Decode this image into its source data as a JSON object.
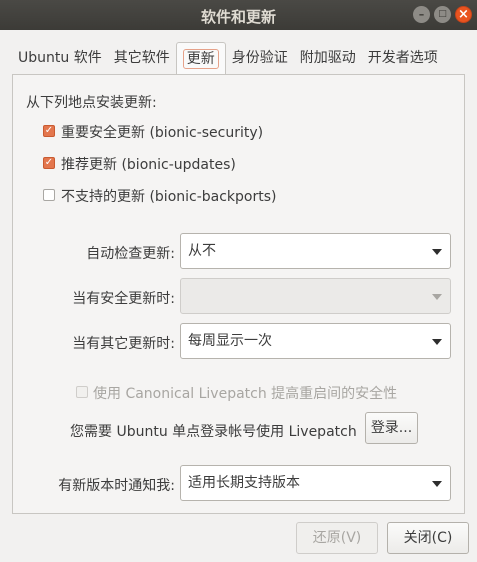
{
  "window": {
    "title": "软件和更新",
    "controls": {
      "minimize_glyph": "–",
      "maximize_glyph": "□",
      "close_glyph": "×"
    }
  },
  "tabs": [
    {
      "label": "Ubuntu 软件"
    },
    {
      "label": "其它软件"
    },
    {
      "label": "更新",
      "active": true
    },
    {
      "label": "身份验证"
    },
    {
      "label": "附加驱动"
    },
    {
      "label": "开发者选项"
    }
  ],
  "updates": {
    "install_from_label": "从下列地点安装更新:",
    "sources": [
      {
        "label": "重要安全更新 (bionic-security)",
        "checked": true
      },
      {
        "label": "推荐更新 (bionic-updates)",
        "checked": true
      },
      {
        "label": "不支持的更新 (bionic-backports)",
        "checked": false
      }
    ],
    "auto_check": {
      "label": "自动检查更新:",
      "value": "从不"
    },
    "security_updates": {
      "label": "当有安全更新时:",
      "value": ""
    },
    "other_updates": {
      "label": "当有其它更新时:",
      "value": "每周显示一次"
    },
    "livepatch": {
      "label": "使用 Canonical Livepatch 提高重启间的安全性",
      "checked": false,
      "enabled": false
    },
    "login_note": "您需要 Ubuntu 单点登录帐号使用 Livepatch",
    "login_button": "登录...",
    "notify_new_version": {
      "label": "有新版本时通知我:",
      "value": "适用长期支持版本"
    }
  },
  "footer": {
    "revert_button": "还原(V)",
    "close_button": "关闭(C)"
  },
  "colors": {
    "accent": "#e95420",
    "checkbox_on": "#e3764d",
    "titlebar": "#3c3b37"
  }
}
